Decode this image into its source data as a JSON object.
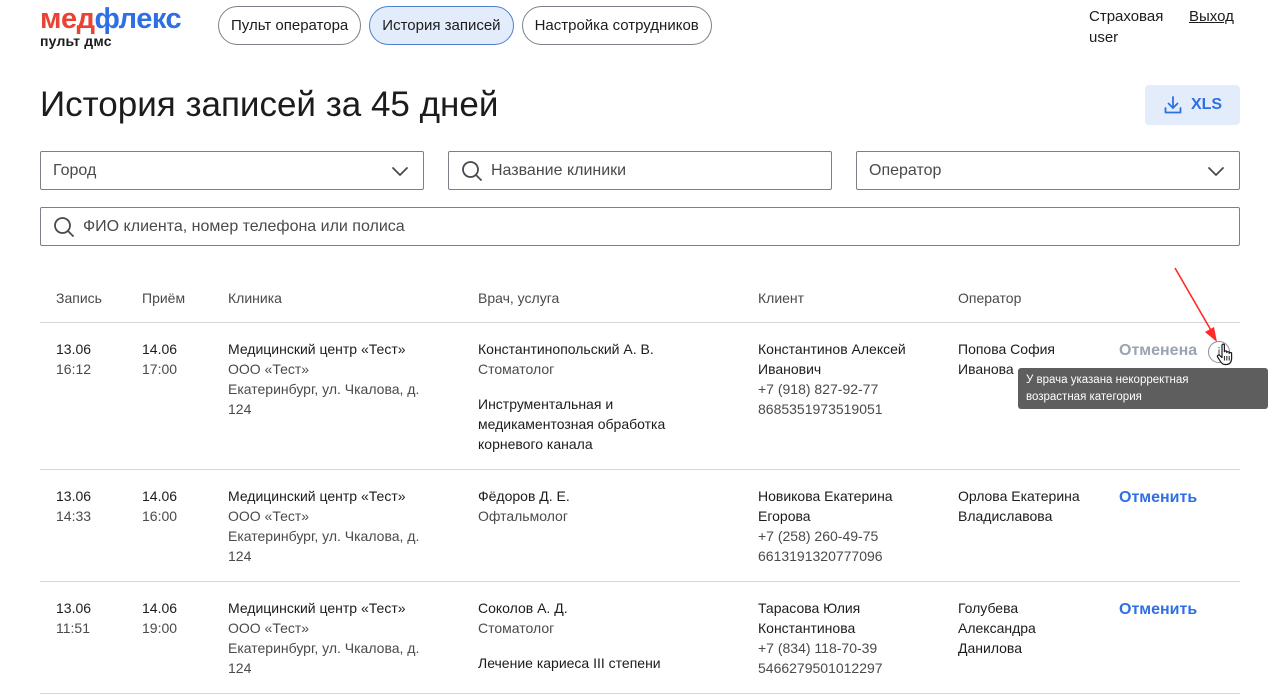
{
  "header": {
    "logo_part1": "мед",
    "logo_part2": "флекс",
    "logo_sub": "пульт дмс",
    "nav": [
      {
        "label": "Пульт оператора",
        "active": false
      },
      {
        "label": "История записей",
        "active": true
      },
      {
        "label": "Настройка сотрудников",
        "active": false
      }
    ],
    "user_line1": "Страховая",
    "user_line2": "user",
    "logout": "Выход"
  },
  "page": {
    "title": "История записей за 45 дней",
    "xls_label": "XLS"
  },
  "filters": {
    "city_placeholder": "Город",
    "clinic_placeholder": "Название клиники",
    "operator_placeholder": "Оператор",
    "client_placeholder": "ФИО клиента, номер телефона или полиса"
  },
  "table": {
    "columns": [
      "Запись",
      "Приём",
      "Клиника",
      "Врач, услуга",
      "Клиент",
      "Оператор"
    ],
    "rows": [
      {
        "rec_date": "13.06",
        "rec_time": "16:12",
        "app_date": "14.06",
        "app_time": "17:00",
        "clinic_name": "Медицинский центр «Тест»",
        "clinic_org": "ООО «Тест»",
        "clinic_addr1": "Екатеринбург, ул. Чкалова, д.",
        "clinic_addr2": "124",
        "doctor": "Константинопольский А. В.",
        "specialty": "Стоматолог",
        "service1": "Инструментальная и",
        "service2": "медикаментозная обработка",
        "service3": "корневого канала",
        "client1": "Константинов Алексей",
        "client2": "Иванович",
        "phone": "+7 (918) 827-92-77",
        "policy": "8685351973519051",
        "operator1": "Попова София",
        "operator2": "Иванова",
        "action": "Отменена"
      },
      {
        "rec_date": "13.06",
        "rec_time": "14:33",
        "app_date": "14.06",
        "app_time": "16:00",
        "clinic_name": "Медицинский центр «Тест»",
        "clinic_org": "ООО «Тест»",
        "clinic_addr1": "Екатеринбург, ул. Чкалова, д.",
        "clinic_addr2": "124",
        "doctor": "Фёдоров Д. Е.",
        "specialty": "Офтальмолог",
        "client1": "Новикова Екатерина",
        "client2": "Егорова",
        "phone": "+7 (258) 260-49-75",
        "policy": "6613191320777096",
        "operator1": "Орлова Екатерина",
        "operator2": "Владиславова",
        "action": "Отменить"
      },
      {
        "rec_date": "13.06",
        "rec_time": "11:51",
        "app_date": "14.06",
        "app_time": "19:00",
        "clinic_name": "Медицинский центр «Тест»",
        "clinic_org": "ООО «Тест»",
        "clinic_addr1": "Екатеринбург, ул. Чкалова, д.",
        "clinic_addr2": "124",
        "doctor": "Соколов А. Д.",
        "specialty": "Стоматолог",
        "service1": "Лечение кариеса III степени",
        "client1": "Тарасова Юлия",
        "client2": "Константинова",
        "phone": "+7 (834) 118-70-39",
        "policy": "5466279501012297",
        "operator1": "Голубева",
        "operator2": "Александра",
        "operator3": "Данилова",
        "action": "Отменить"
      }
    ]
  },
  "tooltip": {
    "line1": "У врача указана некорректная",
    "line2": "возрастная категория"
  },
  "info_icon": "i",
  "colors": {
    "brand_red": "#ea4335",
    "brand_blue": "#2f6fe4",
    "disabled": "#9aa3b0",
    "tooltip_bg": "#5e5e5e",
    "annotation_arrow": "#ff2a2a"
  }
}
